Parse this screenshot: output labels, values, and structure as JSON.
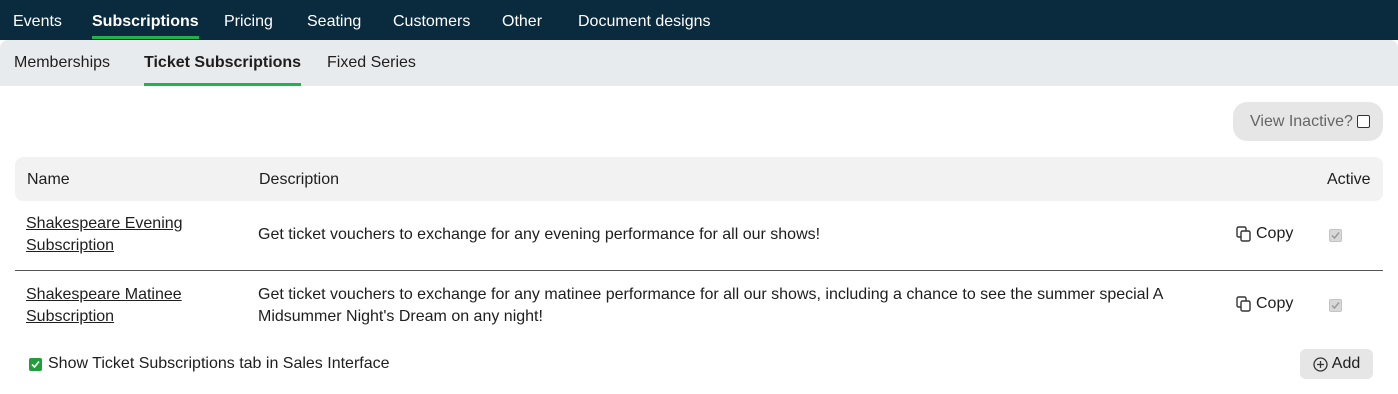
{
  "topnav": {
    "items": [
      {
        "label": "Events"
      },
      {
        "label": "Subscriptions"
      },
      {
        "label": "Pricing"
      },
      {
        "label": "Seating"
      },
      {
        "label": "Customers"
      },
      {
        "label": "Other"
      },
      {
        "label": "Document designs"
      }
    ],
    "active": "Subscriptions"
  },
  "subnav": {
    "items": [
      {
        "label": "Memberships"
      },
      {
        "label": "Ticket Subscriptions"
      },
      {
        "label": "Fixed Series"
      }
    ],
    "active": "Ticket Subscriptions"
  },
  "view_inactive": {
    "label": "View Inactive?",
    "checked": false
  },
  "table": {
    "headers": {
      "name": "Name",
      "description": "Description",
      "active": "Active"
    },
    "rows": [
      {
        "name": "Shakespeare Evening Subscription",
        "description": "Get ticket vouchers to exchange for any evening performance for all our shows!",
        "copy_label": "Copy",
        "active": true
      },
      {
        "name": "Shakespeare Matinee Subscription",
        "description": "Get ticket vouchers to exchange for any matinee performance for all our shows, including a chance to see the summer special A Midsummer Night's Dream on any night!",
        "copy_label": "Copy",
        "active": true
      }
    ]
  },
  "footer": {
    "show_tab_label": "Show Ticket Subscriptions tab in Sales Interface",
    "show_tab_checked": true,
    "add_label": "Add"
  },
  "colors": {
    "topnav_bg": "#0a2a3d",
    "accent_green": "#22b14c",
    "subnav_bg": "#e8ebee"
  }
}
